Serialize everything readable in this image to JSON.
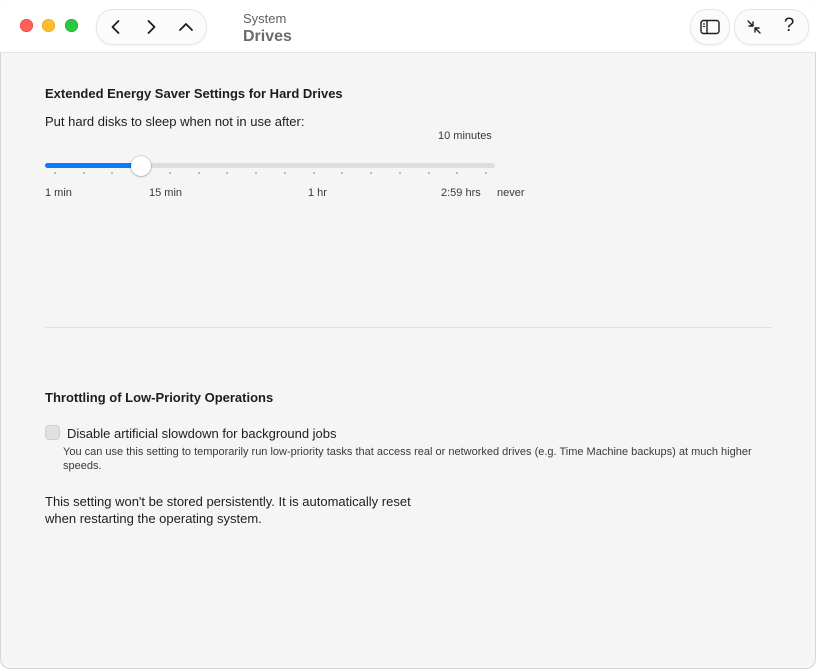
{
  "window": {
    "title_sub": "System",
    "title_main": "Drives",
    "colors": {
      "close": "#fe5f57",
      "minimize": "#febc2e",
      "maximize": "#28c840",
      "accent": "#0a7aff"
    }
  },
  "toolbar": {
    "icons": [
      "chevron-left-icon",
      "chevron-right-icon",
      "chevron-up-icon",
      "sidebar-icon",
      "collapse-icon",
      "help-icon"
    ],
    "help_glyph": "?"
  },
  "energy": {
    "heading": "Extended Energy Saver Settings for Hard Drives",
    "label": "Put hard disks to sleep when not in use after:",
    "value_label": "10 minutes",
    "slider_fraction": 0.21,
    "scale": {
      "min": "1 min",
      "m15": "15 min",
      "hr": "1 hr",
      "max": "2:59 hrs",
      "never": "never"
    }
  },
  "throttling": {
    "heading": "Throttling of Low-Priority Operations",
    "checkbox_label": "Disable artificial slowdown for background jobs",
    "checkbox_checked": false,
    "description": "You can use this setting to temporarily run low-priority tasks that access real or networked drives (e.g. Time Machine backups) at much higher speeds.",
    "note_line1": "This setting won't be stored persistently. It is automatically reset",
    "note_line2": "when restarting the operating system."
  }
}
